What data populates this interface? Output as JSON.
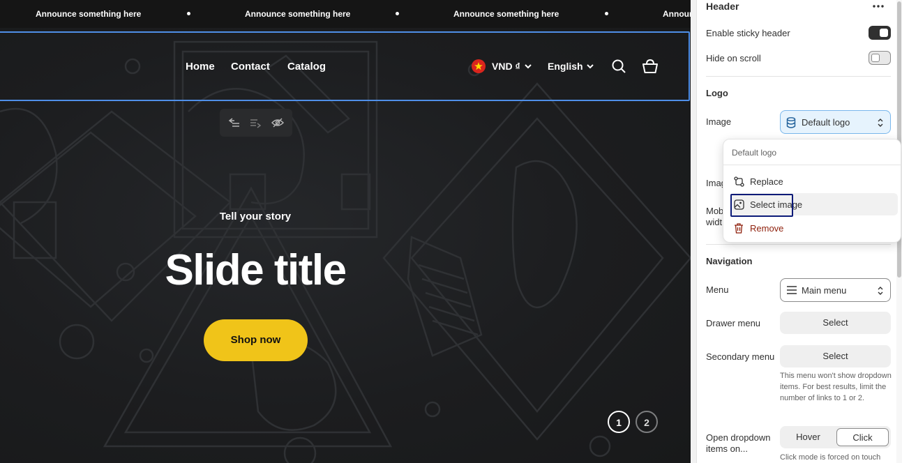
{
  "preview": {
    "announcements": [
      "Announce something here",
      "Announce something here",
      "Announce something here",
      "Announc"
    ],
    "nav": {
      "home": "Home",
      "contact": "Contact",
      "catalog": "Catalog"
    },
    "currency": "VND ₫",
    "language": "English",
    "toolbar_icons": [
      "move-left-icon",
      "move-right-icon",
      "hide-eye-icon"
    ],
    "slide": {
      "subheading": "Tell your story",
      "title": "Slide title",
      "button": "Shop now"
    },
    "slide_dots": [
      "1",
      "2"
    ],
    "colors": {
      "accent": "#f0c419",
      "selection": "#4f8fe8",
      "background": "#1b1c1d"
    }
  },
  "panel": {
    "header_title": "Header",
    "sticky_header": {
      "label": "Enable sticky header",
      "on": true
    },
    "hide_on_scroll": {
      "label": "Hide on scroll",
      "on": false
    },
    "logo": {
      "heading": "Logo",
      "image_label": "Image",
      "image_value": "Default logo",
      "partial_label_1": "Imag",
      "partial_label_2a": "Mob",
      "partial_label_2b": "widt"
    },
    "navigation": {
      "heading": "Navigation",
      "menu_label": "Menu",
      "menu_value": "Main menu",
      "drawer_label": "Drawer menu",
      "drawer_value": "Select",
      "secondary_label": "Secondary menu",
      "secondary_value": "Select",
      "secondary_help": "This menu won't show dropdown items. For best results, limit the number of links to 1 or 2.",
      "open_dropdown_label_1": "Open dropdown",
      "open_dropdown_label_2": "items on...",
      "open_options": [
        "Hover",
        "Click"
      ],
      "open_selected": "Click",
      "click_help": "Click mode is forced on touch"
    },
    "popover": {
      "title": "Default logo",
      "items": [
        {
          "label": "Replace",
          "icon": "replace-icon"
        },
        {
          "label": "Select image",
          "icon": "image-icon"
        },
        {
          "label": "Remove",
          "icon": "trash-icon",
          "color": "#8e1f0b"
        }
      ]
    }
  }
}
